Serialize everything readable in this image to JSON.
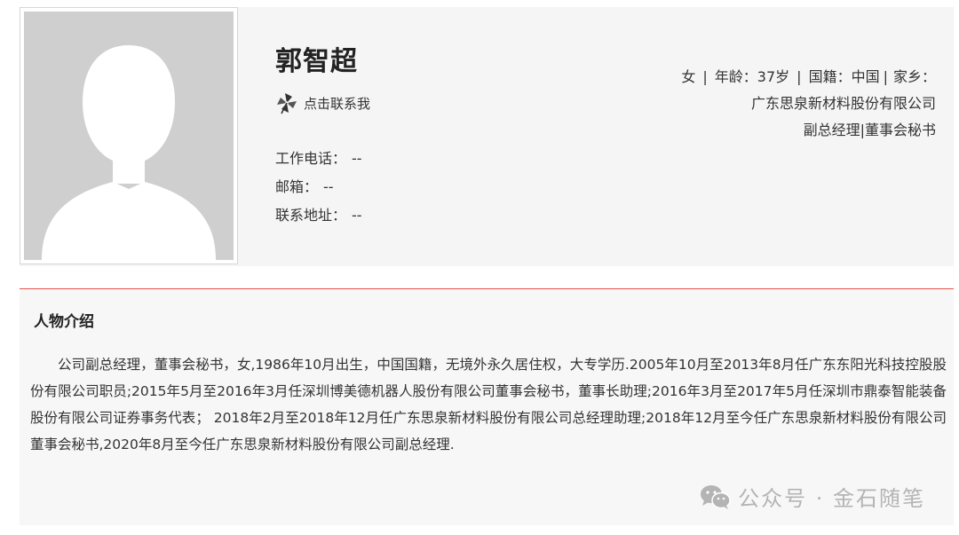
{
  "profile": {
    "name": "郭智超",
    "contact_label": "点击联系我",
    "work_phone_label": "工作电话：",
    "work_phone_value": "--",
    "email_label": "邮箱：",
    "email_value": "--",
    "address_label": "联系地址：",
    "address_value": "--"
  },
  "meta": {
    "gender": "女",
    "age_label": "年龄：",
    "age_value": "37岁",
    "nationality_label": "国籍：",
    "nationality_value": "中国",
    "hometown_label": "家乡：",
    "company": "广东思泉新材料股份有限公司",
    "position": "副总经理|董事会秘书"
  },
  "bio": {
    "title": "人物介绍",
    "text": "公司副总经理，董事会秘书，女,1986年10月出生，中国国籍，无境外永久居住权，大专学历.2005年10月至2013年8月任广东东阳光科技控股股份有限公司职员;2015年5月至2016年3月任深圳博美德机器人股份有限公司董事会秘书，董事长助理;2016年3月至2017年5月任深圳市鼎泰智能装备股份有限公司证券事务代表； 2018年2月至2018年12月任广东思泉新材料股份有限公司总经理助理;2018年12月至今任广东思泉新材料股份有限公司董事会秘书,2020年8月至今任广东思泉新材料股份有限公司副总经理."
  },
  "watermark": {
    "text": "公众号 · 金石随笔",
    "icon": "wechat-icon"
  },
  "colors": {
    "divider": "#e5534b",
    "panel_bg": "#f5f5f5",
    "photo_placeholder": "#cfcfcf"
  }
}
